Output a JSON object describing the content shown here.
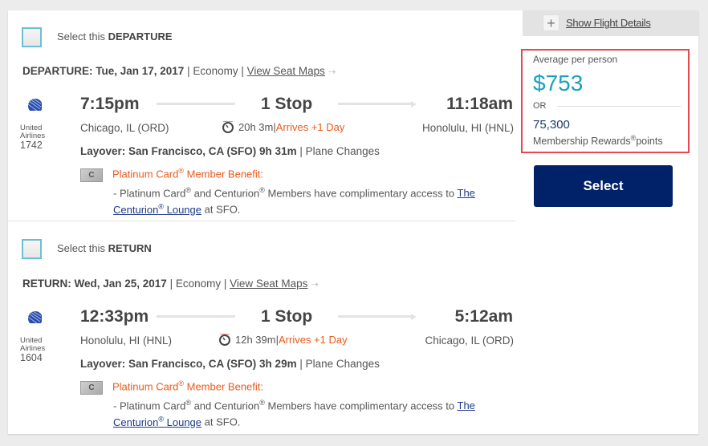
{
  "sidebar": {
    "show_details_label": "Show Flight Details",
    "price_label": "Average per person",
    "price": "$753",
    "or_label": "OR",
    "points": "75,300",
    "points_label_prefix": "Membership Rewards",
    "points_label_suffix": "points",
    "registered": "®",
    "select_label": "Select",
    "highlight_color": "#e8484d",
    "price_color": "#1aa0bf",
    "button_color": "#012169"
  },
  "departure": {
    "select_prefix": "Select this ",
    "select_bold": "DEPARTURE",
    "date_label": "DEPARTURE: Tue, Jan 17, 2017",
    "cabin": " | Economy | ",
    "seat_maps": "View Seat Maps",
    "seat_maps_arrow": "⇢",
    "airline_name_1": "United",
    "airline_name_2": "Airlines",
    "flight_number": "1742",
    "depart_time": "7:15pm",
    "stops": "1 Stop",
    "arrive_time": "11:18am",
    "origin": "Chicago, IL (ORD)",
    "destination": "Honolulu, HI (HNL)",
    "duration": "20h 3m",
    "sep": " | ",
    "arrives_note": "Arrives +1 Day",
    "layover_bold": "Layover: San Francisco, CA (SFO) 9h 31m",
    "layover_rest": " | Plane Changes",
    "benefit_title_1": "Platinum Card",
    "benefit_title_2": " Member Benefit:",
    "benefit_text_1": "- Platinum Card",
    "benefit_text_2": " and Centurion",
    "benefit_text_3": " Members have complimentary access to ",
    "lounge_link_1": "The Centurion",
    "lounge_link_2": " Lounge",
    "benefit_text_4": " at SFO."
  },
  "return": {
    "select_prefix": "Select this ",
    "select_bold": "RETURN",
    "date_label": "RETURN: Wed, Jan 25, 2017",
    "cabin": " | Economy | ",
    "seat_maps": "View Seat Maps",
    "seat_maps_arrow": "⇢",
    "airline_name_1": "United",
    "airline_name_2": "Airlines",
    "flight_number": "1604",
    "depart_time": "12:33pm",
    "stops": "1 Stop",
    "arrive_time": "5:12am",
    "origin": "Honolulu, HI (HNL)",
    "destination": "Chicago, IL (ORD)",
    "duration": "12h 39m",
    "sep": " | ",
    "arrives_note": "Arrives +1 Day",
    "layover_bold": "Layover: San Francisco, CA (SFO) 3h 29m",
    "layover_rest": " | Plane Changes",
    "benefit_title_1": "Platinum Card",
    "benefit_title_2": " Member Benefit:",
    "benefit_text_1": "- Platinum Card",
    "benefit_text_2": " and Centurion",
    "benefit_text_3": " Members have complimentary access to ",
    "lounge_link_1": "The Centurion",
    "lounge_link_2": " Lounge",
    "benefit_text_4": " at SFO."
  }
}
